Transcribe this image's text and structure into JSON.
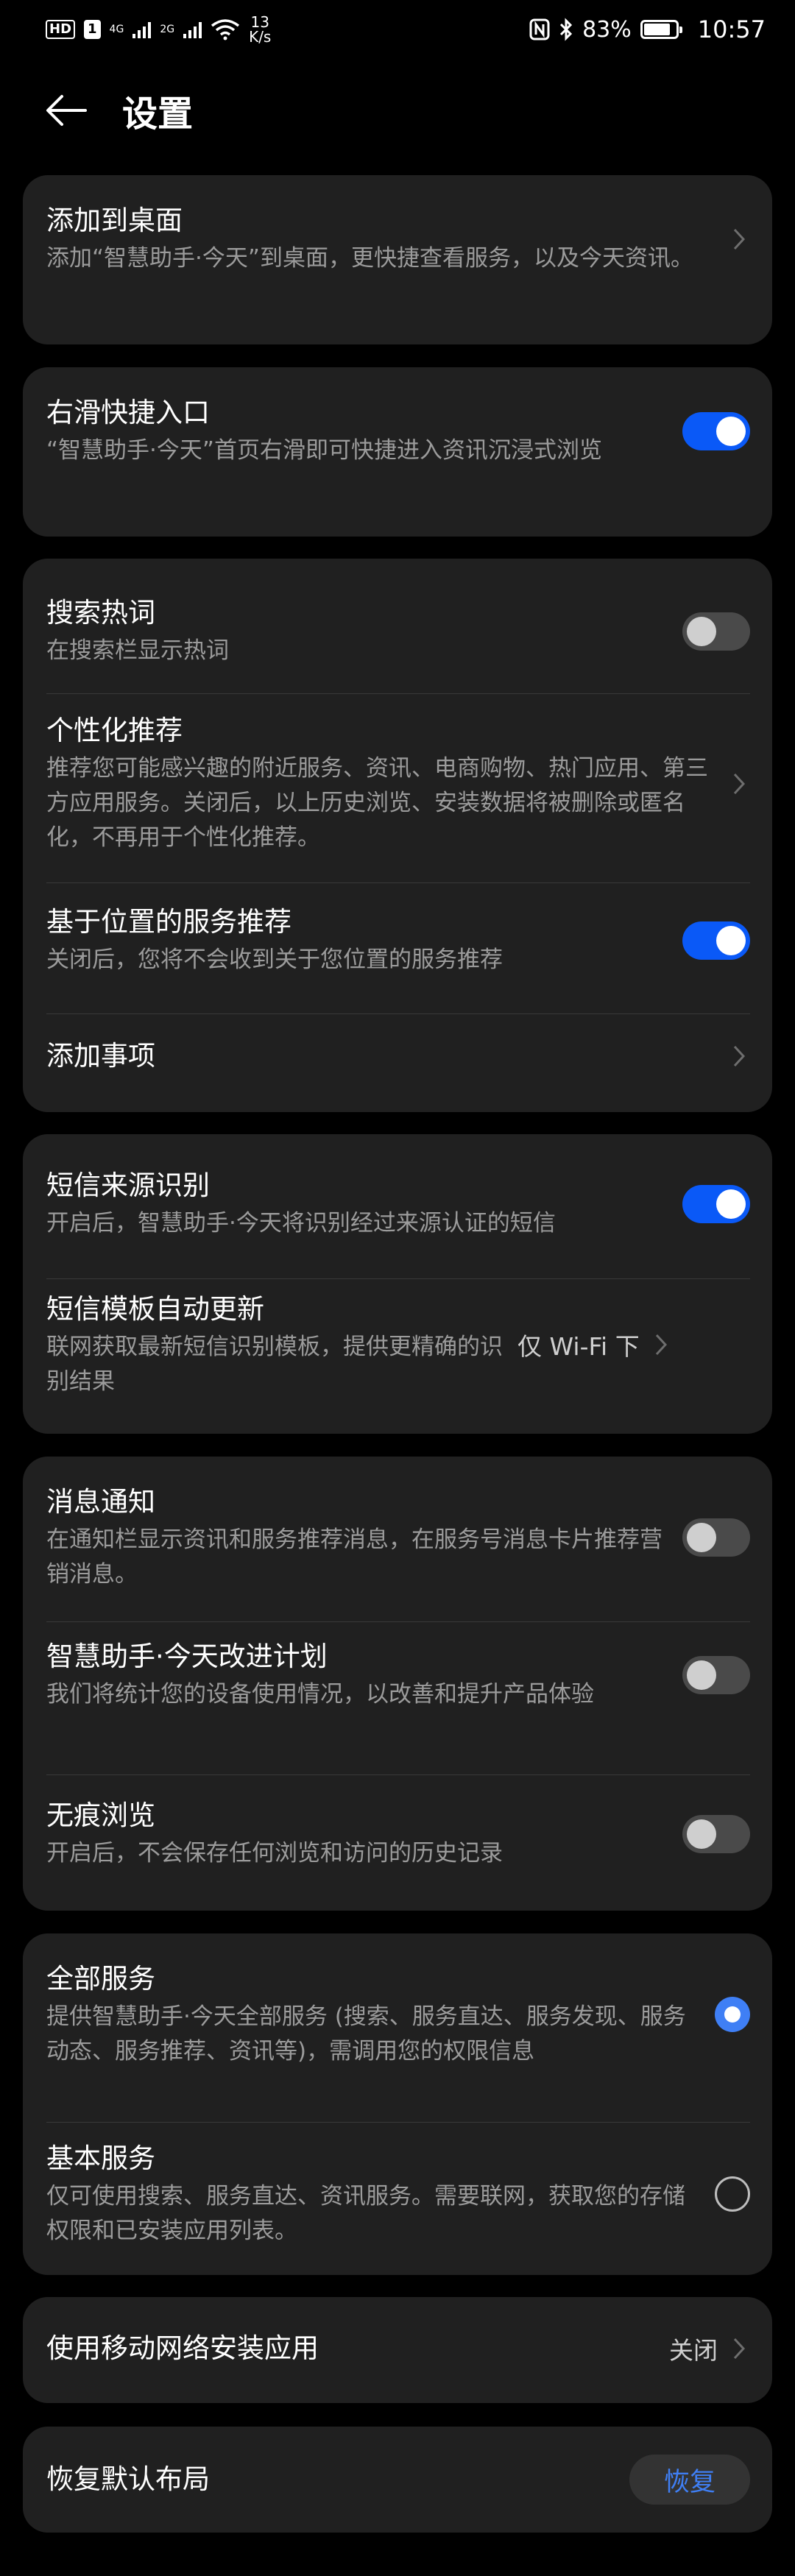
{
  "status_bar": {
    "hd_badge": "HD",
    "sim_slot": "1",
    "net1": "4G",
    "net2": "2G",
    "speed_value": "13",
    "speed_unit": "K/s",
    "battery": "83%",
    "battery_level": 0.83,
    "time": "10:57"
  },
  "header": {
    "title": "设置"
  },
  "sections": {
    "desktop": {
      "title": "添加到桌面",
      "subtitle": "添加“智慧助手·今天”到桌面，更快捷查看服务，以及今天资讯。"
    },
    "swipe": {
      "title": "右滑快捷入口",
      "subtitle": "“智慧助手·今天”首页右滑即可快捷进入资讯沉浸式浏览",
      "enabled": true
    },
    "hot_search": {
      "title": "搜索热词",
      "subtitle": "在搜索栏显示热词",
      "enabled": false
    },
    "personalized": {
      "title": "个性化推荐",
      "subtitle": "推荐您可能感兴趣的附近服务、资讯、电商购物、热门应用、第三方应用服务。关闭后，以上历史浏览、安装数据将被删除或匿名化，不再用于个性化推荐。"
    },
    "location": {
      "title": "基于位置的服务推荐",
      "subtitle": "关闭后，您将不会收到关于您位置的服务推荐",
      "enabled": true
    },
    "add_item": {
      "title": "添加事项"
    },
    "sms_source": {
      "title": "短信来源识别",
      "subtitle": "开启后，智慧助手·今天将识别经过来源认证的短信",
      "enabled": true
    },
    "sms_template": {
      "title": "短信模板自动更新",
      "subtitle": "联网获取最新短信识别模板，提供更精确的识别结果",
      "value": "仅 Wi-Fi 下"
    },
    "notify": {
      "title": "消息通知",
      "subtitle": "在通知栏显示资讯和服务推荐消息，在服务号消息卡片推荐营销消息。",
      "enabled": false
    },
    "improve": {
      "title": "智慧助手·今天改进计划",
      "subtitle": "我们将统计您的设备使用情况，以改善和提升产品体验",
      "enabled": false
    },
    "incognito": {
      "title": "无痕浏览",
      "subtitle": "开启后，不会保存任何浏览和访问的历史记录",
      "enabled": false
    },
    "all_services": {
      "title": "全部服务",
      "subtitle": "提供智慧助手·今天全部服务 (搜索、服务直达、服务发现、服务动态、服务推荐、资讯等)，需调用您的权限信息",
      "selected": true
    },
    "basic_services": {
      "title": "基本服务",
      "subtitle": "仅可使用搜索、服务直达、资讯服务。需要联网，获取您的存储权限和已安装应用列表。",
      "selected": false
    },
    "mobile_install": {
      "title": "使用移动网络安装应用",
      "value": "关闭"
    },
    "restore": {
      "title": "恢复默认布局",
      "button": "恢复"
    }
  },
  "colors": {
    "background": "#000000",
    "card": "#202020",
    "accent": "#0a59f7",
    "secondary_text": "#9b9b9b"
  },
  "icons": [
    "back-arrow-icon",
    "chevron-right-icon",
    "wifi-icon",
    "nfc-icon",
    "bluetooth-icon",
    "battery-icon"
  ]
}
